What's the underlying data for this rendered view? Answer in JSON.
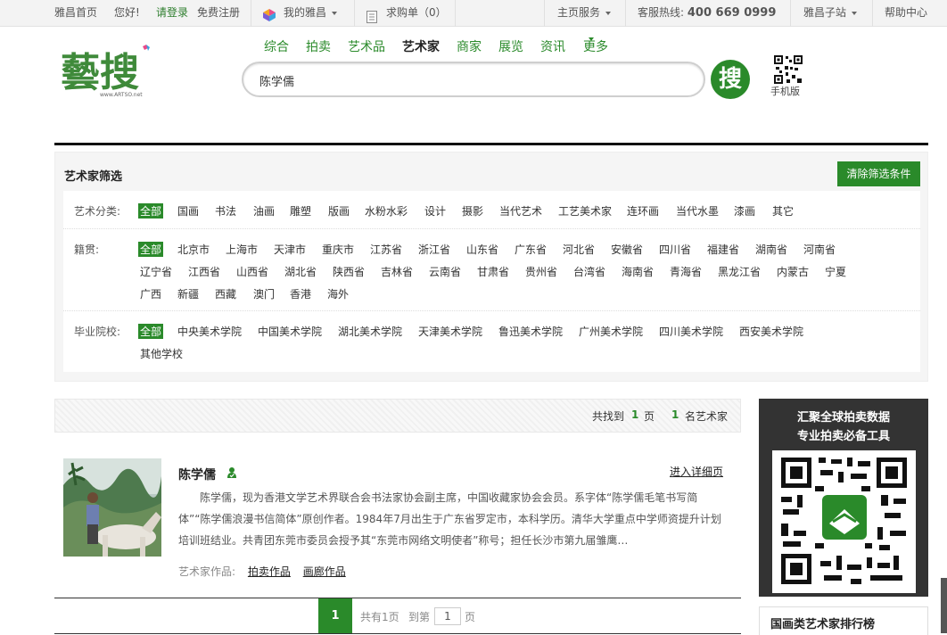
{
  "topbar": {
    "home": "雅昌首页",
    "hello": "您好!",
    "login": "请登录",
    "register": "免费注册",
    "my_artron": "我的雅昌",
    "wishlist": "求购单",
    "wishlist_count": "（0）",
    "services": "主页服务",
    "hotline_label": "客服热线:",
    "hotline": "400 669 0999",
    "substations": "雅昌子站",
    "help": "帮助中心"
  },
  "logo": {
    "text": "藝搜",
    "sub": "www.ARTSO.net"
  },
  "nav": {
    "items": [
      "综合",
      "拍卖",
      "艺术品",
      "艺术家",
      "商家",
      "展览",
      "资讯",
      "更多"
    ],
    "active": "艺术家"
  },
  "search": {
    "value": "陈学儒",
    "button": "搜"
  },
  "mobile": {
    "label": "手机版"
  },
  "filter": {
    "title": "艺术家筛选",
    "clear": "清除筛选条件",
    "category": {
      "label": "艺术分类:",
      "options": [
        "全部",
        "国画",
        "书法",
        "油画",
        "雕塑",
        "版画",
        "水粉水彩",
        "设计",
        "摄影",
        "当代艺术",
        "工艺美术家",
        "连环画",
        "当代水墨",
        "漆画",
        "其它"
      ]
    },
    "origin": {
      "label": "籍贯:",
      "options": [
        "全部",
        "北京市",
        "上海市",
        "天津市",
        "重庆市",
        "江苏省",
        "浙江省",
        "山东省",
        "广东省",
        "河北省",
        "安徽省",
        "四川省",
        "福建省",
        "湖南省",
        "河南省",
        "辽宁省",
        "江西省",
        "山西省",
        "湖北省",
        "陕西省",
        "吉林省",
        "云南省",
        "甘肃省",
        "贵州省",
        "台湾省",
        "海南省",
        "青海省",
        "黑龙江省",
        "内蒙古",
        "宁夏",
        "广西",
        "新疆",
        "西藏",
        "澳门",
        "香港",
        "海外"
      ]
    },
    "school": {
      "label": "毕业院校:",
      "options": [
        "全部",
        "中央美术学院",
        "中国美术学院",
        "湖北美术学院",
        "天津美术学院",
        "鲁迅美术学院",
        "广州美术学院",
        "四川美术学院",
        "西安美术学院",
        "其他学校"
      ]
    }
  },
  "results": {
    "found_prefix": "共找到",
    "pages": "1",
    "pages_unit": "页",
    "count": "1",
    "count_unit": "名艺术家"
  },
  "artist": {
    "name": "陈学儒",
    "detail_link": "进入详细页",
    "bio": "陈学儒，现为香港文学艺术界联合会书法家协会副主席，中国收藏家协会会员。系字体“陈学儒毛笔书写简体”“陈学儒浪漫书信简体”原创作者。1984年7月出生于广东省罗定市，本科学历。清华大学重点中学师资提升计划培训班结业。共青团东莞市委员会授予其“东莞市网络文明使者”称号；担任长沙市第九届雏鹰…",
    "works_label": "艺术家作品:",
    "works_auction": "拍卖作品",
    "works_gallery": "画廊作品"
  },
  "pagination": {
    "current": "1",
    "total_text": "共有1页",
    "goto_label": "到第",
    "goto_value": "1",
    "page_unit": "页"
  },
  "ad": {
    "line1": "汇聚全球拍卖数据",
    "line2": "专业拍卖必备工具"
  },
  "rank": {
    "title": "国画类艺术家排行榜"
  },
  "colors": {
    "accent": "#2a8a2a",
    "ad_bg": "#333333"
  }
}
